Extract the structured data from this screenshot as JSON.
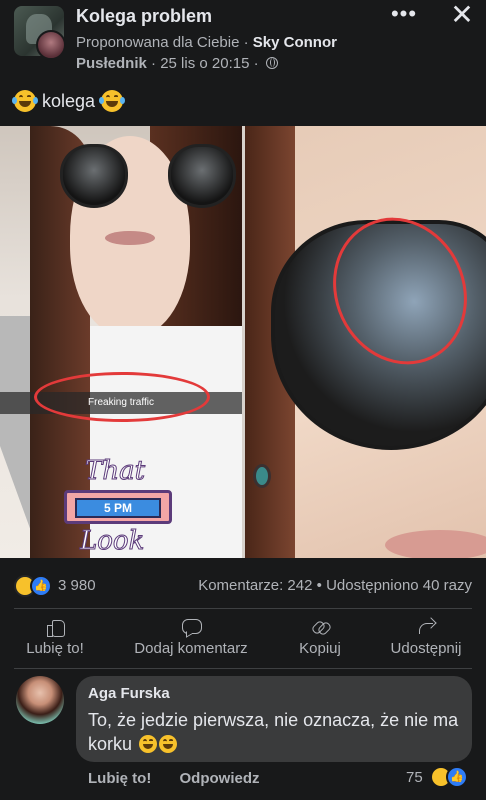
{
  "post": {
    "group_name": "Kolega problem",
    "suggested_label": "Proponowana dla Ciebie",
    "separator": "·",
    "author": "Sky Connor",
    "subtitle_role": "Pusłednik",
    "timestamp": "25 lis o 20:15",
    "caption_text": "kolega",
    "more_icon": "more-horizontal-icon",
    "close_icon": "close-icon"
  },
  "image": {
    "overlay_text": "Freaking traffic",
    "sticker_top": "That",
    "sticker_clock": "5 PM",
    "sticker_bottom": "Look"
  },
  "stats": {
    "reactions_count": "3 980",
    "comments": "Komentarze: 242",
    "dot": "•",
    "shares": "Udostępniono 40 razy"
  },
  "actions": {
    "like": "Lubię to!",
    "comment": "Dodaj komentarz",
    "copy": "Kopiuj",
    "share": "Udostępnij"
  },
  "comment": {
    "author": "Aga Furska",
    "text": "To, że jedzie pierwsza, nie oznacza, że nie ma korku",
    "like": "Lubię to!",
    "reply": "Odpowiedz",
    "reactions_count": "75"
  },
  "colors": {
    "background": "#18191a",
    "bubble": "#3a3b3c",
    "secondary_text": "#b0b3b8",
    "like_blue": "#2e7cf6",
    "haha_yellow": "#f7c12b",
    "annotation_red": "#e33a3a"
  }
}
